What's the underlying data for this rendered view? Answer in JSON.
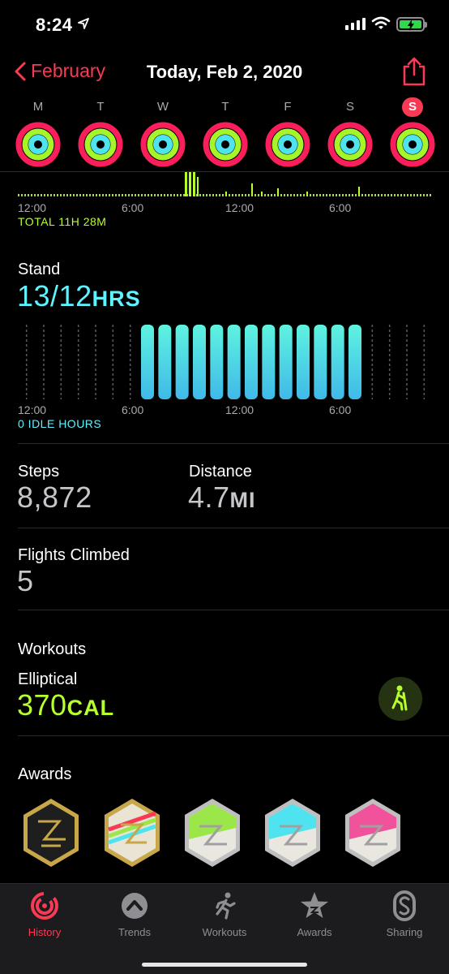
{
  "status_bar": {
    "time": "8:24"
  },
  "nav": {
    "back_label": "February",
    "title": "Today, Feb 2, 2020"
  },
  "week": {
    "days": [
      {
        "letter": "M",
        "active": false
      },
      {
        "letter": "T",
        "active": false
      },
      {
        "letter": "W",
        "active": false
      },
      {
        "letter": "T",
        "active": false
      },
      {
        "letter": "F",
        "active": false
      },
      {
        "letter": "S",
        "active": false
      },
      {
        "letter": "S",
        "active": true
      }
    ]
  },
  "exercise": {
    "time_labels": [
      "12:00",
      "6:00",
      "12:00",
      "6:00"
    ],
    "total": "TOTAL 11H 28M"
  },
  "stand": {
    "label": "Stand",
    "value": "13/12",
    "unit": "HRS",
    "time_labels": [
      "12:00",
      "6:00",
      "12:00",
      "6:00"
    ],
    "idle": "0 IDLE HOURS",
    "hours_stood": 13
  },
  "steps": {
    "label": "Steps",
    "value": "8,872"
  },
  "distance": {
    "label": "Distance",
    "value": "4.7",
    "unit": "MI"
  },
  "flights": {
    "label": "Flights Climbed",
    "value": "5"
  },
  "workouts": {
    "label": "Workouts",
    "type": "Elliptical",
    "value": "370",
    "unit": "CAL"
  },
  "awards": {
    "label": "Awards"
  },
  "tabs": [
    {
      "label": "History",
      "icon": "history-icon",
      "active": true
    },
    {
      "label": "Trends",
      "icon": "trends-icon",
      "active": false
    },
    {
      "label": "Workouts",
      "icon": "workouts-icon",
      "active": false
    },
    {
      "label": "Awards",
      "icon": "awards-icon",
      "active": false
    },
    {
      "label": "Sharing",
      "icon": "sharing-icon",
      "active": false
    }
  ],
  "colors": {
    "accent": "#fa3a55",
    "move": "#fa1e5a",
    "exercise": "#b6ff2e",
    "stand": "#5ef3ff",
    "tab_bar": "#1c1c1e"
  }
}
